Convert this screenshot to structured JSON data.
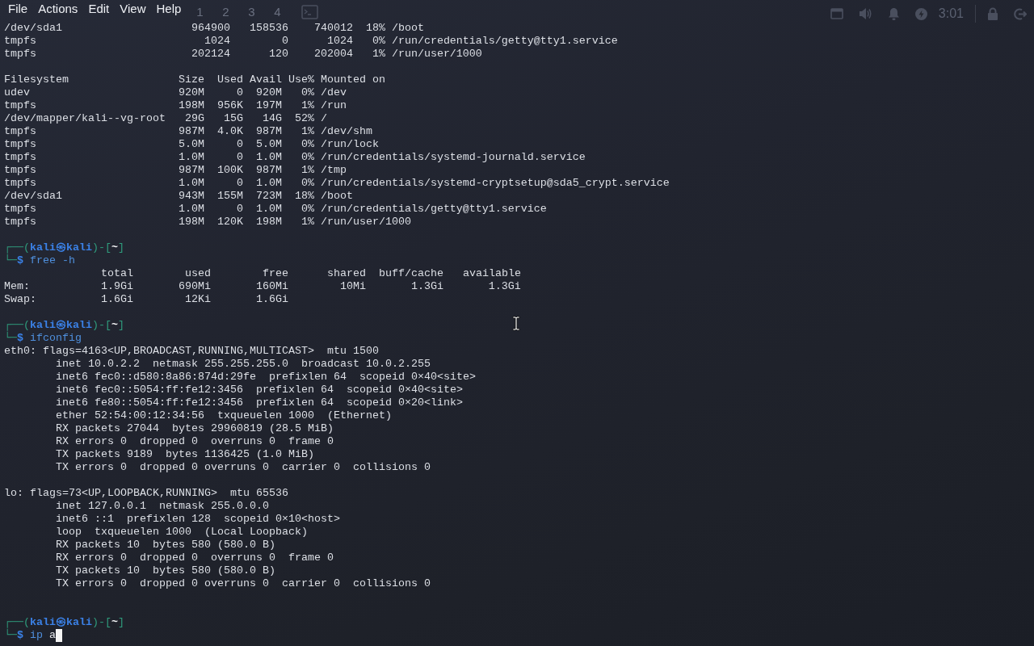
{
  "menu_bar": {
    "items": [
      "File",
      "Actions",
      "Edit",
      "View",
      "Help"
    ]
  },
  "panel": {
    "workspaces": [
      "1",
      "2",
      "3",
      "4"
    ],
    "clock": "3:01"
  },
  "terminal": {
    "lines": [
      {
        "kind": "output",
        "text": "/dev/sda1                    964900   158536    740012  18% /boot"
      },
      {
        "kind": "output",
        "text": "tmpfs                          1024        0      1024   0% /run/credentials/getty@tty1.service"
      },
      {
        "kind": "output",
        "text": "tmpfs                        202124      120    202004   1% /run/user/1000"
      },
      {
        "kind": "blank"
      },
      {
        "kind": "output",
        "text": "Filesystem                 Size  Used Avail Use% Mounted on"
      },
      {
        "kind": "output",
        "text": "udev                       920M     0  920M   0% /dev"
      },
      {
        "kind": "output",
        "text": "tmpfs                      198M  956K  197M   1% /run"
      },
      {
        "kind": "output",
        "text": "/dev/mapper/kali--vg-root   29G   15G   14G  52% /"
      },
      {
        "kind": "output",
        "text": "tmpfs                      987M  4.0K  987M   1% /dev/shm"
      },
      {
        "kind": "output",
        "text": "tmpfs                      5.0M     0  5.0M   0% /run/lock"
      },
      {
        "kind": "output",
        "text": "tmpfs                      1.0M     0  1.0M   0% /run/credentials/systemd-journald.service"
      },
      {
        "kind": "output",
        "text": "tmpfs                      987M  100K  987M   1% /tmp"
      },
      {
        "kind": "output",
        "text": "tmpfs                      1.0M     0  1.0M   0% /run/credentials/systemd-cryptsetup@sda5_crypt.service"
      },
      {
        "kind": "output",
        "text": "/dev/sda1                  943M  155M  723M  18% /boot"
      },
      {
        "kind": "output",
        "text": "tmpfs                      1.0M     0  1.0M   0% /run/credentials/getty@tty1.service"
      },
      {
        "kind": "output",
        "text": "tmpfs                      198M  120K  198M   1% /run/user/1000"
      },
      {
        "kind": "blank"
      },
      {
        "kind": "prompt",
        "segments": [
          {
            "kind": "frame",
            "text": "┌──("
          },
          {
            "kind": "user",
            "text": "kali㉿kali"
          },
          {
            "kind": "frame",
            "text": ")-["
          },
          {
            "kind": "path",
            "text": "~"
          },
          {
            "kind": "frame",
            "text": "]"
          }
        ]
      },
      {
        "kind": "command",
        "cursor": false,
        "segments": [
          {
            "kind": "frame",
            "text": "└─"
          },
          {
            "kind": "symbol",
            "text": "$"
          },
          {
            "kind": "command",
            "text": " free -h"
          }
        ]
      },
      {
        "kind": "output",
        "text": "               total        used        free      shared  buff/cache   available"
      },
      {
        "kind": "output",
        "text": "Mem:           1.9Gi       690Mi       160Mi        10Mi       1.3Gi       1.3Gi"
      },
      {
        "kind": "output",
        "text": "Swap:          1.6Gi        12Ki       1.6Gi"
      },
      {
        "kind": "blank"
      },
      {
        "kind": "prompt",
        "segments": [
          {
            "kind": "frame",
            "text": "┌──("
          },
          {
            "kind": "user",
            "text": "kali㉿kali"
          },
          {
            "kind": "frame",
            "text": ")-["
          },
          {
            "kind": "path",
            "text": "~"
          },
          {
            "kind": "frame",
            "text": "]"
          }
        ]
      },
      {
        "kind": "command",
        "cursor": false,
        "segments": [
          {
            "kind": "frame",
            "text": "└─"
          },
          {
            "kind": "symbol",
            "text": "$"
          },
          {
            "kind": "command",
            "text": " ifconfig"
          }
        ]
      },
      {
        "kind": "output",
        "text": "eth0: flags=4163<UP,BROADCAST,RUNNING,MULTICAST>  mtu 1500"
      },
      {
        "kind": "output",
        "text": "        inet 10.0.2.2  netmask 255.255.255.0  broadcast 10.0.2.255"
      },
      {
        "kind": "output",
        "text": "        inet6 fec0::d580:8a86:874d:29fe  prefixlen 64  scopeid 0×40<site>"
      },
      {
        "kind": "output",
        "text": "        inet6 fec0::5054:ff:fe12:3456  prefixlen 64  scopeid 0×40<site>"
      },
      {
        "kind": "output",
        "text": "        inet6 fe80::5054:ff:fe12:3456  prefixlen 64  scopeid 0×20<link>"
      },
      {
        "kind": "output",
        "text": "        ether 52:54:00:12:34:56  txqueuelen 1000  (Ethernet)"
      },
      {
        "kind": "output",
        "text": "        RX packets 27044  bytes 29960819 (28.5 MiB)"
      },
      {
        "kind": "output",
        "text": "        RX errors 0  dropped 0  overruns 0  frame 0"
      },
      {
        "kind": "output",
        "text": "        TX packets 9189  bytes 1136425 (1.0 MiB)"
      },
      {
        "kind": "output",
        "text": "        TX errors 0  dropped 0 overruns 0  carrier 0  collisions 0"
      },
      {
        "kind": "blank"
      },
      {
        "kind": "output",
        "text": "lo: flags=73<UP,LOOPBACK,RUNNING>  mtu 65536"
      },
      {
        "kind": "output",
        "text": "        inet 127.0.0.1  netmask 255.0.0.0"
      },
      {
        "kind": "output",
        "text": "        inet6 ::1  prefixlen 128  scopeid 0×10<host>"
      },
      {
        "kind": "output",
        "text": "        loop  txqueuelen 1000  (Local Loopback)"
      },
      {
        "kind": "output",
        "text": "        RX packets 10  bytes 580 (580.0 B)"
      },
      {
        "kind": "output",
        "text": "        RX errors 0  dropped 0  overruns 0  frame 0"
      },
      {
        "kind": "output",
        "text": "        TX packets 10  bytes 580 (580.0 B)"
      },
      {
        "kind": "output",
        "text": "        TX errors 0  dropped 0 overruns 0  carrier 0  collisions 0"
      },
      {
        "kind": "blank"
      },
      {
        "kind": "blank"
      },
      {
        "kind": "prompt",
        "segments": [
          {
            "kind": "frame",
            "text": "┌──("
          },
          {
            "kind": "user",
            "text": "kali㉿kali"
          },
          {
            "kind": "frame",
            "text": ")-["
          },
          {
            "kind": "path",
            "text": "~"
          },
          {
            "kind": "frame",
            "text": "]"
          }
        ]
      },
      {
        "kind": "command",
        "cursor": true,
        "segments": [
          {
            "kind": "frame",
            "text": "└─"
          },
          {
            "kind": "symbol",
            "text": "$"
          },
          {
            "kind": "command",
            "text": " ip"
          },
          {
            "kind": "argument",
            "text": " a"
          }
        ]
      }
    ]
  }
}
